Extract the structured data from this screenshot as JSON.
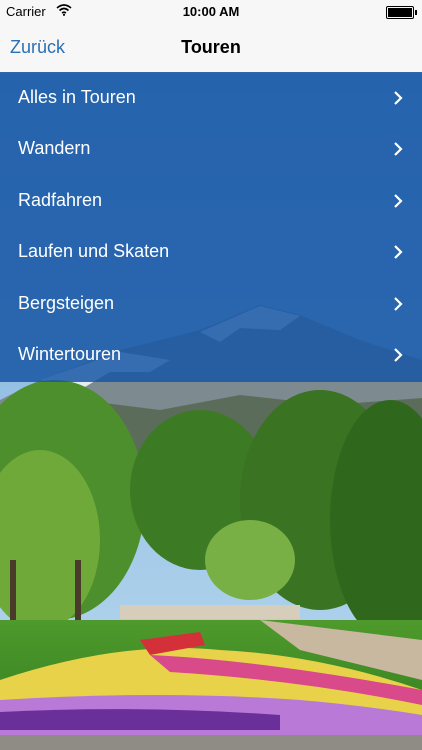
{
  "status_bar": {
    "carrier": "Carrier",
    "time": "10:00 AM"
  },
  "nav": {
    "back_label": "Zurück",
    "title": "Touren"
  },
  "menu": {
    "items": [
      {
        "label": "Alles in Touren"
      },
      {
        "label": "Wandern"
      },
      {
        "label": "Radfahren"
      },
      {
        "label": "Laufen und Skaten"
      },
      {
        "label": "Bergsteigen"
      },
      {
        "label": "Wintertouren"
      }
    ]
  },
  "colors": {
    "menu_bg": "#1857a5",
    "accent": "#2d6fb3"
  }
}
